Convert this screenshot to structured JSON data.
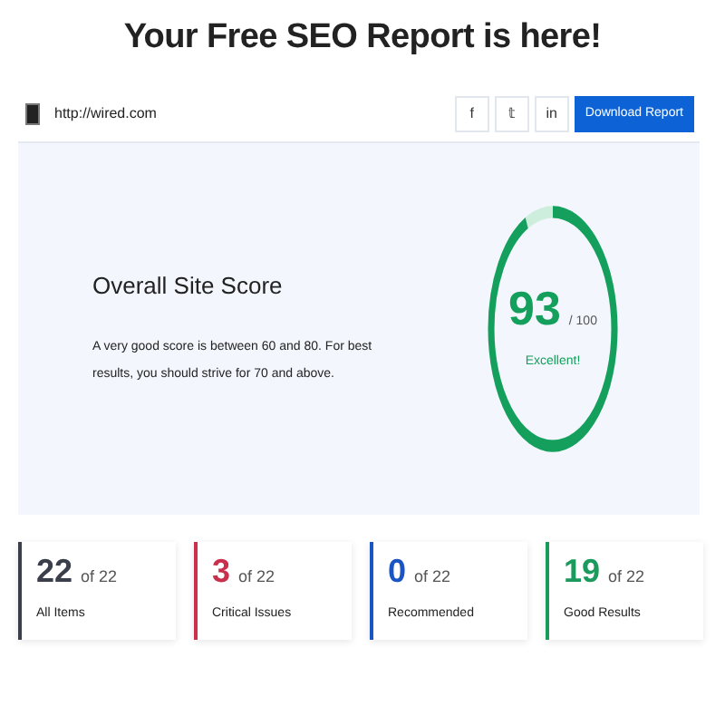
{
  "title": "Your Free SEO Report is here!",
  "site": {
    "url": "http://wired.com"
  },
  "share_buttons": [
    {
      "label": "f"
    },
    {
      "label": "𝕥"
    },
    {
      "label": "in"
    }
  ],
  "download_button": "Download Report",
  "score": {
    "heading": "Overall Site Score",
    "description": "A very good score is between 60 and 80. For best results, you should strive for 70 and above.",
    "value": "93",
    "max": "/ 100",
    "rating": "Excellent!"
  },
  "summary": [
    {
      "count": "22",
      "total": "of 22",
      "label": "All Items",
      "color": "#3a3f4b"
    },
    {
      "count": "3",
      "total": "of 22",
      "label": "Critical Issues",
      "color": "#c8304e"
    },
    {
      "count": "0",
      "total": "of 22",
      "label": "Recommended",
      "color": "#1b55c4"
    },
    {
      "count": "19",
      "total": "of 22",
      "label": "Good Results",
      "color": "#1a9a5c"
    }
  ]
}
